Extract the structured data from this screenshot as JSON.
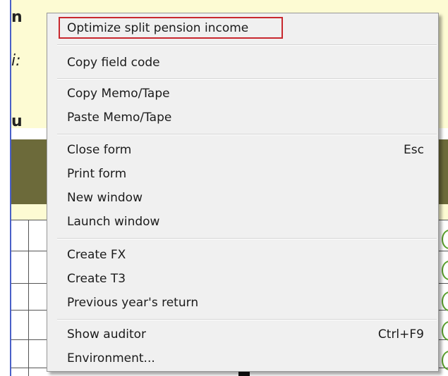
{
  "background": {
    "visible_fragments": [
      "n",
      "i:",
      "u"
    ]
  },
  "menu": {
    "items": [
      {
        "label": "Optimize split pension income",
        "shortcut": ""
      },
      {
        "label": "Copy field code",
        "shortcut": ""
      },
      {
        "label": "Copy Memo/Tape",
        "shortcut": ""
      },
      {
        "label": "Paste Memo/Tape",
        "shortcut": ""
      },
      {
        "label": "Close form",
        "shortcut": "Esc"
      },
      {
        "label": "Print form",
        "shortcut": ""
      },
      {
        "label": "New window",
        "shortcut": ""
      },
      {
        "label": "Launch window",
        "shortcut": ""
      },
      {
        "label": "Create FX",
        "shortcut": ""
      },
      {
        "label": "Create T3",
        "shortcut": ""
      },
      {
        "label": "Previous year's return",
        "shortcut": ""
      },
      {
        "label": "Show auditor",
        "shortcut": "Ctrl+F9"
      },
      {
        "label": "Environment...",
        "shortcut": ""
      }
    ],
    "highlight_color": "#c8282e"
  }
}
